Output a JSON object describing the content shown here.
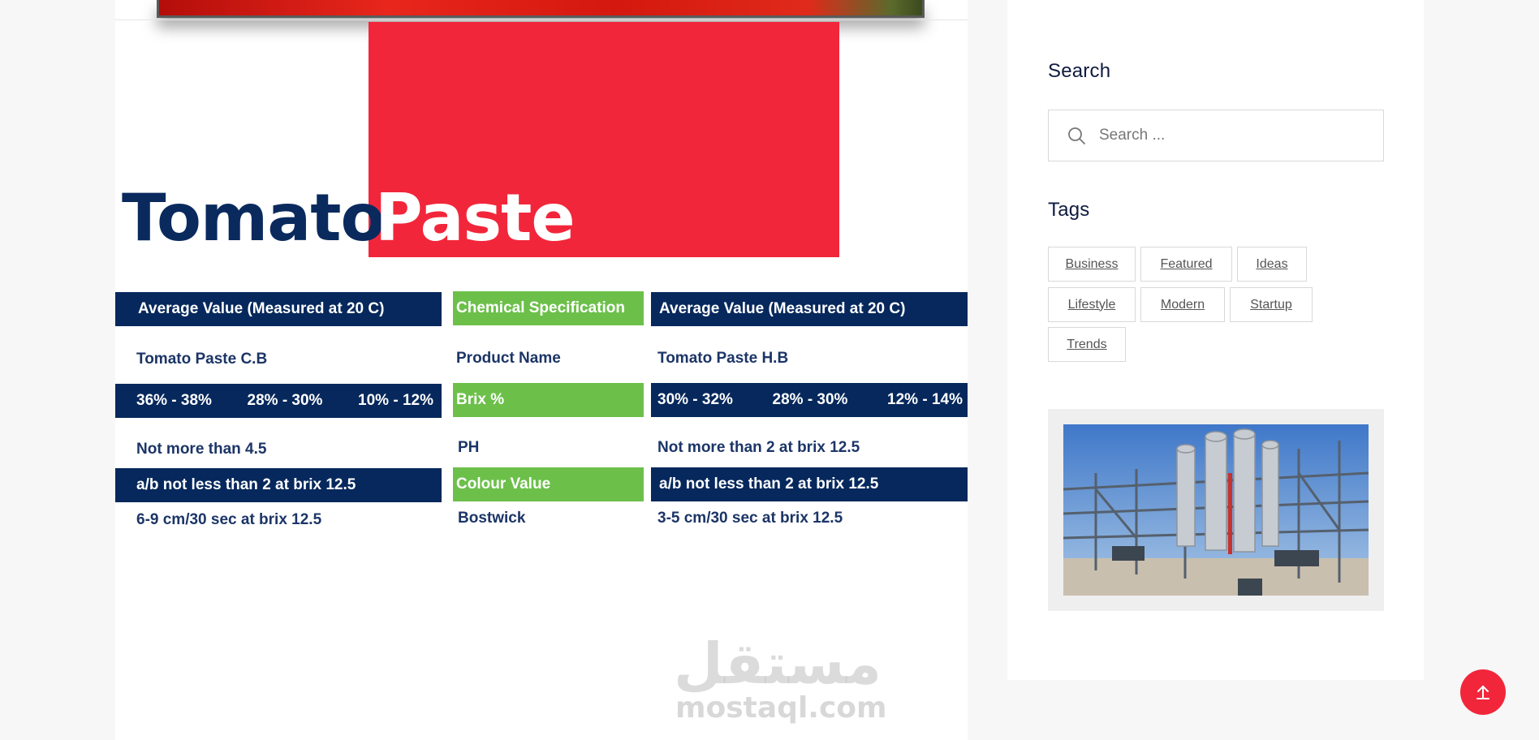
{
  "poster": {
    "title_left": "Tomato",
    "title_right": "Paste",
    "left": {
      "header": "Average Value (Measured at 20 C)",
      "product": "Tomato Paste C.B",
      "brix": [
        "36% - 38%",
        "28% - 30%",
        "10% - 12%"
      ],
      "ph": "Not more than 4.5",
      "colour": "a/b not less than 2 at brix 12.5",
      "bostwick": "6-9 cm/30 sec at brix 12.5"
    },
    "middle": {
      "header": "Chemical Specification",
      "product": "Product Name",
      "brix": "Brix %",
      "ph": "PH",
      "colour": "Colour Value",
      "bostwick": "Bostwick"
    },
    "right": {
      "header": "Average Value (Measured at 20 C)",
      "product": "Tomato Paste H.B",
      "brix": [
        "30% - 32%",
        "28% - 30%",
        "12% - 14%"
      ],
      "ph": "Not more than 2 at brix 12.5",
      "colour": "a/b not less than 2 at brix 12.5",
      "bostwick": "3-5 cm/30 sec at brix 12.5"
    },
    "watermark_ar": "مستقل",
    "watermark_en": "mostaql.com"
  },
  "sidebar": {
    "search_heading": "Search",
    "search_placeholder": "Search ...",
    "tags_heading": "Tags",
    "tags": [
      "Business",
      "Featured",
      "Ideas",
      "Lifestyle",
      "Modern",
      "Startup",
      "Trends"
    ]
  },
  "icons": {
    "search": "search-icon",
    "back_to_top": "arrow-up-icon"
  },
  "colors": {
    "navy": "#06285c",
    "red": "#f2263b",
    "green": "#6cc04a"
  }
}
